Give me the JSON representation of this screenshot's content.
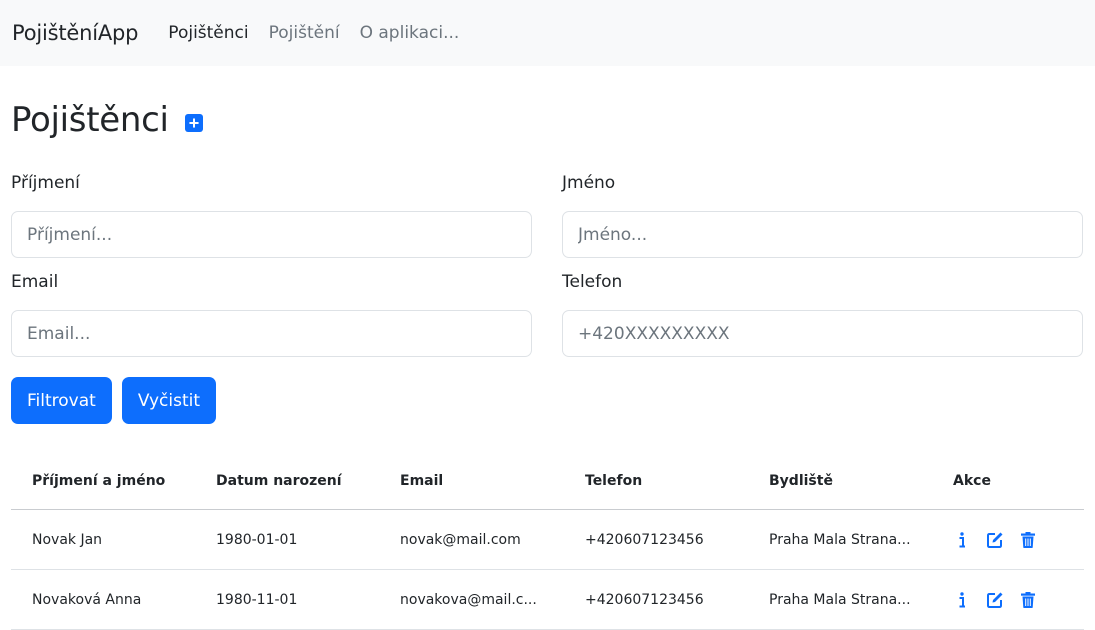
{
  "navbar": {
    "brand": "PojištěníApp",
    "links": [
      "Pojištěnci",
      "Pojištění",
      "O aplikaci..."
    ]
  },
  "page": {
    "title": "Pojištěnci",
    "add_icon": "plus-square-icon"
  },
  "filter": {
    "surname": {
      "label": "Příjmení",
      "placeholder": "Příjmení..."
    },
    "name": {
      "label": "Jméno",
      "placeholder": "Jméno..."
    },
    "email": {
      "label": "Email",
      "placeholder": "Email..."
    },
    "phone": {
      "label": "Telefon",
      "placeholder": "+420XXXXXXXXX"
    },
    "filter_button": "Filtrovat",
    "clear_button": "Vyčistit"
  },
  "table": {
    "headers": [
      "Příjmení a jméno",
      "Datum narození",
      "Email",
      "Telefon",
      "Bydliště",
      "Akce"
    ],
    "rows": [
      [
        "Novak Jan",
        "1980-01-01",
        "novak@mail.com",
        "+420607123456",
        "Praha Mala Strana..."
      ],
      [
        "Novaková Anna",
        "1980-11-01",
        "novakova@mail.c...",
        "+420607123456",
        "Praha Mala Strana..."
      ]
    ],
    "action_icons": [
      "info-icon",
      "edit-icon",
      "trash-icon"
    ]
  },
  "colors": {
    "primary": "#0d6efd",
    "navbar_bg": "#f8f9fa",
    "text": "#212529",
    "muted": "#6c757d"
  }
}
